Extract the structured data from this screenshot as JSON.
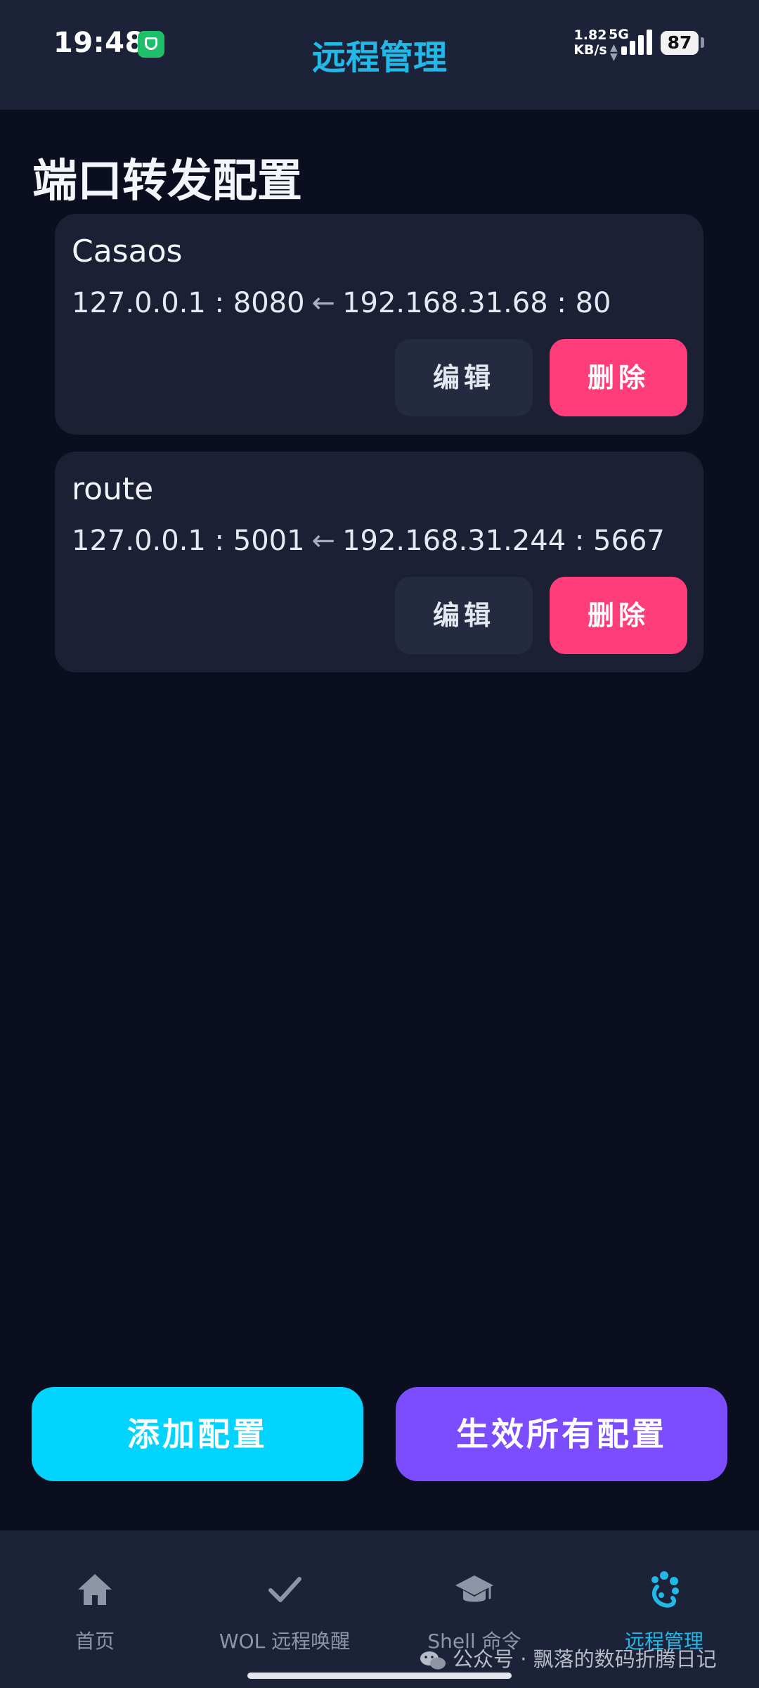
{
  "status_bar": {
    "time": "19:48",
    "net_speed": "1.82 KB/s",
    "net_type": "5G",
    "battery": "87"
  },
  "header": {
    "title": "远程管理"
  },
  "page": {
    "title": "端口转发配置"
  },
  "configs": [
    {
      "name": "Casaos",
      "local": "127.0.0.1 : 8080",
      "arrow": "←",
      "remote": "192.168.31.68 : 80",
      "edit_label": "编辑",
      "delete_label": "删除"
    },
    {
      "name": "route",
      "local": "127.0.0.1 : 5001",
      "arrow": "←",
      "remote": "192.168.31.244 : 5667",
      "edit_label": "编辑",
      "delete_label": "删除"
    }
  ],
  "actions": {
    "add_label": "添加配置",
    "apply_label": "生效所有配置"
  },
  "nav": {
    "items": [
      {
        "label": "首页",
        "icon": "home-icon",
        "active": false
      },
      {
        "label": "WOL 远程唤醒",
        "icon": "check-icon",
        "active": false
      },
      {
        "label": "Shell 命令",
        "icon": "graduation-cap-icon",
        "active": false
      },
      {
        "label": "远程管理",
        "icon": "remote-icon",
        "active": true
      }
    ]
  },
  "watermark": {
    "text": "公众号 · 飘落的数码折腾日记"
  },
  "colors": {
    "background": "#0a0e1e",
    "bar": "#1c2338",
    "card": "#1b2034",
    "accent": "#22b8e8",
    "add_button": "#00d4ff",
    "apply_button": "#7c4dff",
    "delete_button": "#ff3d7a",
    "edit_button": "#242b40"
  }
}
